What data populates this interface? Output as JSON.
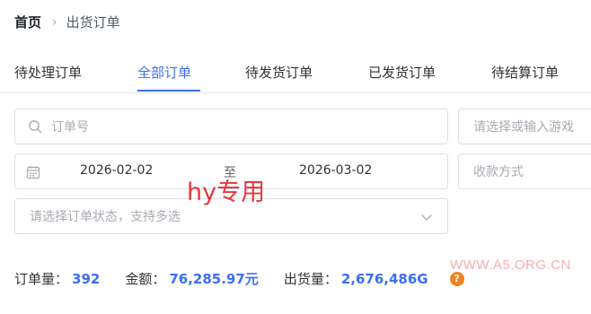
{
  "breadcrumb": {
    "home": "首页",
    "separator": "›",
    "current": "出货订单"
  },
  "tabs": [
    {
      "label": "待处理订单",
      "active": false
    },
    {
      "label": "全部订单",
      "active": true
    },
    {
      "label": "待发货订单",
      "active": false
    },
    {
      "label": "已发货订单",
      "active": false
    },
    {
      "label": "待结算订单",
      "active": false
    }
  ],
  "filters": {
    "order_no_placeholder": "订单号",
    "game_placeholder": "请选择或输入游戏",
    "date_start": "2026-02-02",
    "date_to": "至",
    "date_end": "2026-03-02",
    "payment_placeholder": "收款方式",
    "status_placeholder": "请选择订单状态，支持多选"
  },
  "watermarks": {
    "hy": "hy专用",
    "site": "WWW.A5.ORG.CN"
  },
  "stats": {
    "order_count_label": "订单量：",
    "order_count": "392",
    "amount_label": "金额：",
    "amount": "76,285.97元",
    "shipped_label": "出货量：",
    "shipped": "2,676,486G"
  },
  "colors": {
    "accent": "#3a6ff7",
    "help_badge": "#f0831e",
    "watermark_red": "#e8373e"
  },
  "icons": [
    "search-icon",
    "calendar-icon",
    "chevron-down-icon",
    "help-icon"
  ]
}
